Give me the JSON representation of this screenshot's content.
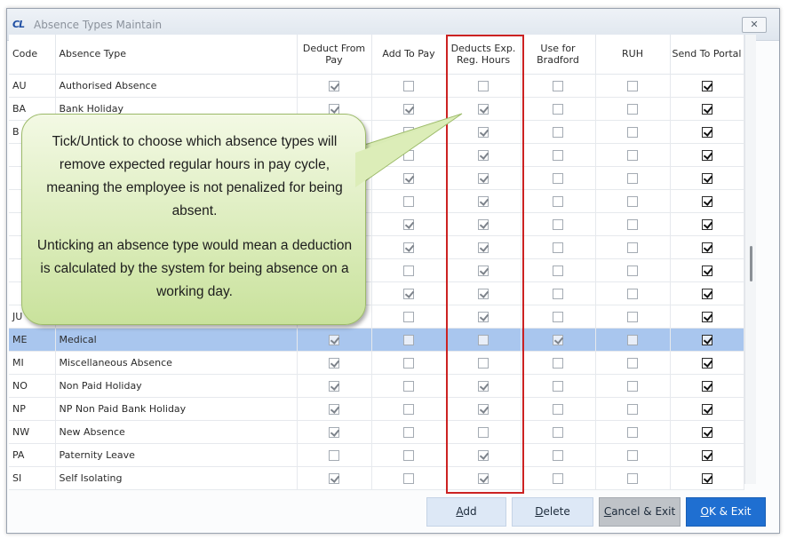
{
  "window": {
    "title": "Absence Types Maintain",
    "logo": "CL",
    "close_icon": "close-icon"
  },
  "columns": [
    "Code",
    "Absence Type",
    "Deduct From Pay",
    "Add To Pay",
    "Deducts Exp. Reg. Hours",
    "Use for Bradford",
    "RUH",
    "Send To Portal"
  ],
  "rows": [
    {
      "code": "AU",
      "name": "Authorised Absence",
      "flags": [
        true,
        false,
        false,
        false,
        false,
        true
      ]
    },
    {
      "code": "BA",
      "name": "Bank Holiday",
      "flags": [
        true,
        true,
        true,
        false,
        false,
        true
      ]
    },
    {
      "code": "B",
      "name": "",
      "flags": [
        false,
        false,
        true,
        false,
        false,
        true
      ]
    },
    {
      "code": "",
      "name": "",
      "flags": [
        false,
        false,
        true,
        false,
        false,
        true
      ]
    },
    {
      "code": "",
      "name": "",
      "flags": [
        false,
        true,
        true,
        false,
        false,
        true
      ]
    },
    {
      "code": "",
      "name": "",
      "flags": [
        false,
        false,
        true,
        false,
        false,
        true
      ]
    },
    {
      "code": "",
      "name": "",
      "flags": [
        false,
        true,
        true,
        false,
        false,
        true
      ]
    },
    {
      "code": "",
      "name": "",
      "flags": [
        false,
        true,
        true,
        false,
        false,
        true
      ]
    },
    {
      "code": "",
      "name": "",
      "flags": [
        false,
        false,
        true,
        false,
        false,
        true
      ]
    },
    {
      "code": "",
      "name": "",
      "flags": [
        false,
        true,
        true,
        false,
        false,
        true
      ]
    },
    {
      "code": "JU",
      "name": "",
      "flags": [
        false,
        false,
        true,
        false,
        false,
        true
      ]
    },
    {
      "code": "ME",
      "name": "Medical",
      "flags": [
        true,
        false,
        false,
        true,
        false,
        true
      ],
      "selected": true
    },
    {
      "code": "MI",
      "name": "Miscellaneous Absence",
      "flags": [
        true,
        false,
        false,
        false,
        false,
        true
      ]
    },
    {
      "code": "NO",
      "name": "Non Paid Holiday",
      "flags": [
        true,
        false,
        true,
        false,
        false,
        true
      ]
    },
    {
      "code": "NP",
      "name": "NP Non Paid Bank Holiday",
      "flags": [
        true,
        false,
        true,
        false,
        false,
        true
      ]
    },
    {
      "code": "NW",
      "name": "New Absence",
      "flags": [
        true,
        false,
        false,
        false,
        false,
        true
      ]
    },
    {
      "code": "PA",
      "name": "Paternity Leave",
      "flags": [
        false,
        false,
        true,
        false,
        false,
        true
      ]
    },
    {
      "code": "SI",
      "name": "Self Isolating",
      "flags": [
        true,
        false,
        true,
        false,
        false,
        true
      ]
    }
  ],
  "callout": {
    "paragraph1": "Tick/Untick to choose which absence types will remove expected regular hours in pay cycle, meaning the employee is not penalized for being absent.",
    "paragraph2": "Unticking an absence type would mean a deduction is calculated by the system for being absence on a working day."
  },
  "buttons": {
    "add_u": "A",
    "add_rest": "dd",
    "delete_u": "D",
    "delete_rest": "elete",
    "cancel_u": "C",
    "cancel_rest": "ancel & Exit",
    "ok_u": "O",
    "ok_rest": "K & Exit"
  },
  "colors": {
    "selected_row": "#a9c6ee",
    "callout_fill": "#c9e29c",
    "highlight_border": "#cc2222",
    "ok_button": "#1f6fd1",
    "cancel_button": "#bfc3c8"
  }
}
